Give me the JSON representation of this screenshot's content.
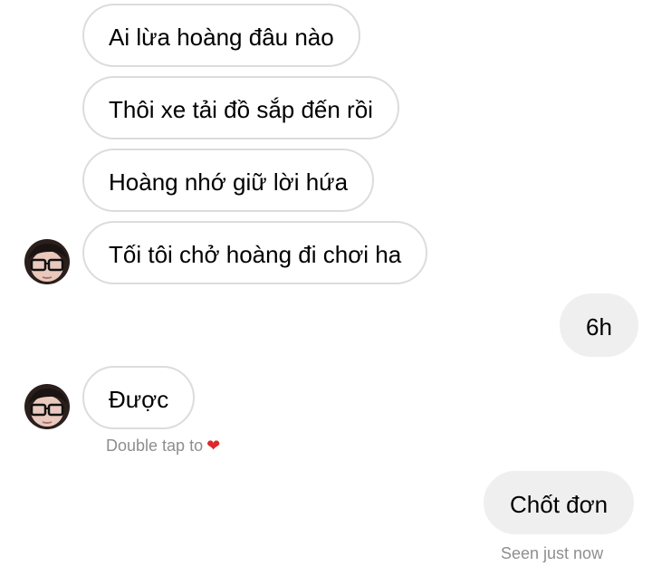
{
  "conversation": {
    "incoming_group_1": [
      {
        "text": "Ai lừa hoàng đâu nào"
      },
      {
        "text": "Thôi xe tải đồ sắp đến rồi"
      },
      {
        "text": "Hoàng nhớ giữ lời hứa"
      },
      {
        "text": "Tối tôi chở hoàng đi chơi ha"
      }
    ],
    "outgoing_1": {
      "text": "6h"
    },
    "incoming_2": {
      "text": "Được"
    },
    "double_tap_hint": "Double tap to",
    "heart_glyph": "❤",
    "outgoing_2": {
      "text": "Chốt đơn"
    },
    "seen_status": "Seen just now"
  },
  "colors": {
    "incoming_bubble_border": "#dcdcdc",
    "outgoing_bubble_bg": "#efefef",
    "caption_text": "#8e8e8e",
    "heart": "#e0282b"
  },
  "icons": [
    "avatar-image",
    "heart-icon"
  ]
}
